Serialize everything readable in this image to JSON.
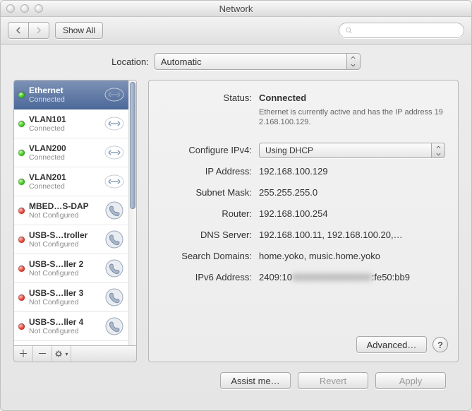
{
  "window": {
    "title": "Network"
  },
  "toolbar": {
    "show_all": "Show All",
    "search_placeholder": ""
  },
  "location": {
    "label": "Location:",
    "value": "Automatic"
  },
  "sidebar": {
    "items": [
      {
        "name": "Ethernet",
        "sub": "Connected",
        "status": "green",
        "icon": "ethernet",
        "selected": true
      },
      {
        "name": "VLAN101",
        "sub": "Connected",
        "status": "green",
        "icon": "ethernet",
        "selected": false
      },
      {
        "name": "VLAN200",
        "sub": "Connected",
        "status": "green",
        "icon": "ethernet",
        "selected": false
      },
      {
        "name": "VLAN201",
        "sub": "Connected",
        "status": "green",
        "icon": "ethernet",
        "selected": false
      },
      {
        "name": "MBED…S-DAP",
        "sub": "Not Configured",
        "status": "red",
        "icon": "modem",
        "selected": false
      },
      {
        "name": "USB-S…troller",
        "sub": "Not Configured",
        "status": "red",
        "icon": "modem",
        "selected": false
      },
      {
        "name": "USB-S…ller 2",
        "sub": "Not Configured",
        "status": "red",
        "icon": "modem",
        "selected": false
      },
      {
        "name": "USB-S…ller 3",
        "sub": "Not Configured",
        "status": "red",
        "icon": "modem",
        "selected": false
      },
      {
        "name": "USB-S…ller 4",
        "sub": "Not Configured",
        "status": "red",
        "icon": "modem",
        "selected": false
      }
    ]
  },
  "details": {
    "status_label": "Status:",
    "status_value": "Connected",
    "status_desc": "Ethernet is currently active and has the IP address 192.168.100.129.",
    "configure_label": "Configure IPv4:",
    "configure_value": "Using DHCP",
    "ip_label": "IP Address:",
    "ip_value": "192.168.100.129",
    "subnet_label": "Subnet Mask:",
    "subnet_value": "255.255.255.0",
    "router_label": "Router:",
    "router_value": "192.168.100.254",
    "dns_label": "DNS Server:",
    "dns_value": "192.168.100.11, 192.168.100.20,…",
    "search_label": "Search Domains:",
    "search_value": "home.yoko, music.home.yoko",
    "ipv6_label": "IPv6 Address:",
    "ipv6_prefix": "2409:10",
    "ipv6_redacted": "XXXXXXXXXXXXX",
    "ipv6_suffix": ":fe50:bb9",
    "advanced": "Advanced…"
  },
  "footer": {
    "assist": "Assist me…",
    "revert": "Revert",
    "apply": "Apply"
  }
}
